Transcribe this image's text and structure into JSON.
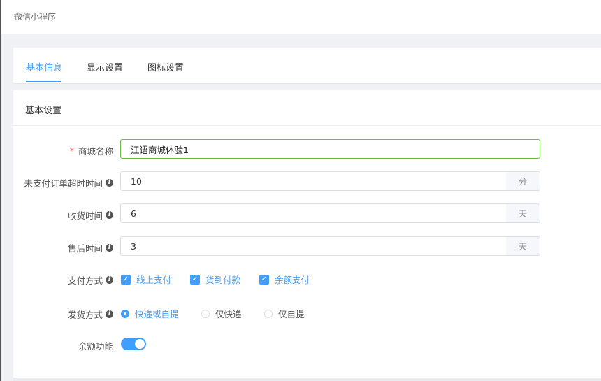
{
  "breadcrumb": {
    "title": "微信小程序"
  },
  "tabs": [
    {
      "label": "基本信息",
      "active": true
    },
    {
      "label": "显示设置",
      "active": false
    },
    {
      "label": "图标设置",
      "active": false
    }
  ],
  "section": {
    "title": "基本设置"
  },
  "form": {
    "shop_name": {
      "label": "商城名称",
      "required_mark": "*",
      "value": "江语商城体验1"
    },
    "unpaid_timeout": {
      "label": "未支付订单超时时间",
      "value": "10",
      "unit": "分"
    },
    "receive_time": {
      "label": "收货时间",
      "value": "6",
      "unit": "天"
    },
    "after_sale_time": {
      "label": "售后时间",
      "value": "3",
      "unit": "天"
    },
    "payment_methods": {
      "label": "支付方式",
      "options": [
        {
          "label": "线上支付",
          "checked": true
        },
        {
          "label": "货到付款",
          "checked": true
        },
        {
          "label": "余额支付",
          "checked": true
        }
      ]
    },
    "shipping_method": {
      "label": "发货方式",
      "options": [
        {
          "label": "快递或自提",
          "selected": true
        },
        {
          "label": "仅快递",
          "selected": false
        },
        {
          "label": "仅自提",
          "selected": false
        }
      ]
    },
    "balance_feature": {
      "label": "余额功能",
      "enabled": true
    }
  },
  "icons": {
    "info": "info-icon",
    "check": "check-icon"
  },
  "colors": {
    "accent": "#409eff",
    "focus_border": "#67c23a",
    "required": "#f56c6c"
  }
}
